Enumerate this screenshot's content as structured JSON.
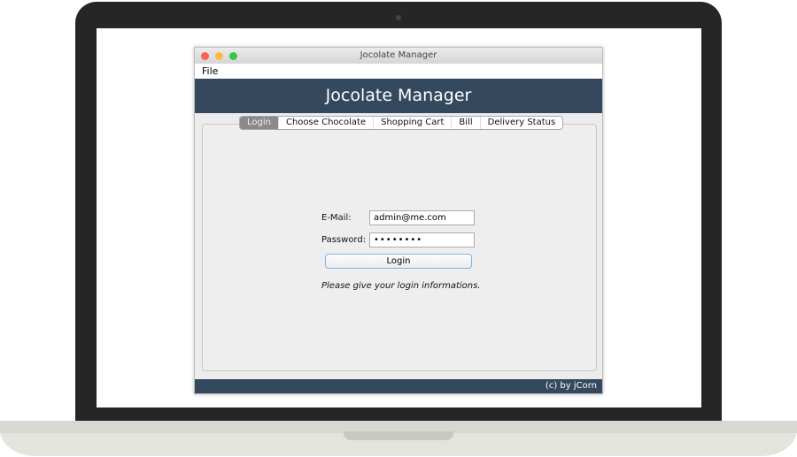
{
  "window": {
    "title": "Jocolate Manager"
  },
  "menu": {
    "items": [
      "File"
    ]
  },
  "header": {
    "title": "Jocolate Manager"
  },
  "tabs": [
    {
      "label": "Login",
      "active": true
    },
    {
      "label": "Choose Chocolate"
    },
    {
      "label": "Shopping Cart"
    },
    {
      "label": "Bill"
    },
    {
      "label": "Delivery Status"
    }
  ],
  "form": {
    "email_label": "E-Mail:",
    "email_value": "admin@me.com",
    "password_label": "Password:",
    "password_value": "••••••••",
    "login_label": "Login",
    "message": "Please give your login informations."
  },
  "footer": {
    "text": "(c) by jCorn"
  },
  "colors": {
    "header": "#34495e",
    "traffic_close": "#fc605b",
    "traffic_min": "#fdbc40",
    "traffic_max": "#34c84a"
  }
}
